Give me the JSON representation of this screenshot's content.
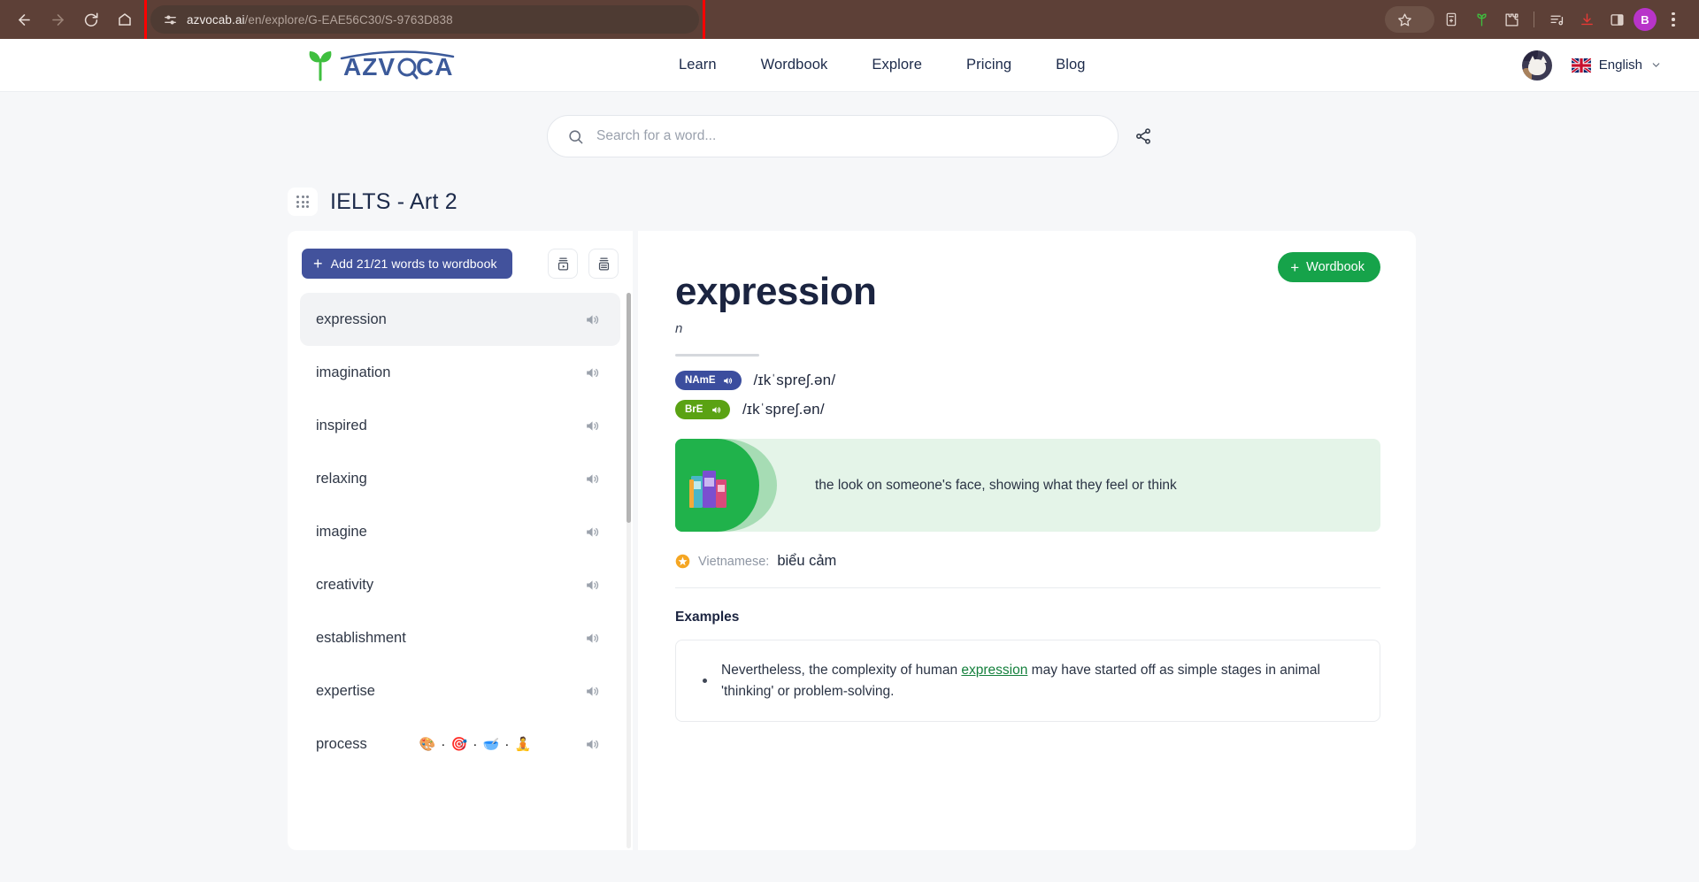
{
  "browser": {
    "url_host": "azvocab.ai",
    "url_path": "/en/explore/G-EAE56C30/S-9763D838",
    "profile_initial": "B"
  },
  "header": {
    "logo_text": "AZVOCAB",
    "nav": [
      {
        "label": "Learn"
      },
      {
        "label": "Wordbook"
      },
      {
        "label": "Explore"
      },
      {
        "label": "Pricing"
      },
      {
        "label": "Blog"
      }
    ],
    "language": "English"
  },
  "search": {
    "value": "",
    "placeholder": "Search for a word..."
  },
  "page": {
    "title": "IELTS - Art 2"
  },
  "left_panel": {
    "add_button_label": "Add 21/21 words to wordbook",
    "words": [
      {
        "label": "expression",
        "active": true
      },
      {
        "label": "imagination",
        "active": false
      },
      {
        "label": "inspired",
        "active": false
      },
      {
        "label": "relaxing",
        "active": false
      },
      {
        "label": "imagine",
        "active": false
      },
      {
        "label": "creativity",
        "active": false
      },
      {
        "label": "establishment",
        "active": false
      },
      {
        "label": "expertise",
        "active": false
      },
      {
        "label": "process",
        "active": false,
        "emoji": "🎨 · 🎯 · 🥣 · 🧘"
      }
    ]
  },
  "entry": {
    "wordbook_button_label": "Wordbook",
    "headword": "expression",
    "part_of_speech": "n",
    "pronunciations": [
      {
        "variant": "NAmE",
        "ipa": "/ɪkˈspreʃ.ən/"
      },
      {
        "variant": "BrE",
        "ipa": "/ɪkˈspreʃ.ən/"
      }
    ],
    "definition": "the look on someone's face, showing what they feel or think",
    "translation_label": "Vietnamese:",
    "translation_value": "biểu cảm",
    "examples_heading": "Examples",
    "examples": [
      {
        "before": "Nevertheless, the complexity of human ",
        "highlight": "expression",
        "after": " may have started off as simple stages in animal 'thinking' or problem-solving."
      }
    ]
  },
  "colors": {
    "chrome_bg": "#5d4037",
    "accent_indigo": "#42529c",
    "accent_green": "#16a34a",
    "badge_name": "#3b4d9e",
    "badge_bre": "#5aa213",
    "highlight_box": "#ff0000"
  }
}
